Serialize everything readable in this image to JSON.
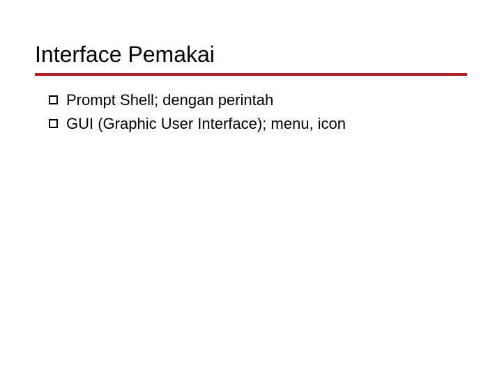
{
  "slide": {
    "title": "Interface Pemakai",
    "bullets": [
      {
        "text": "Prompt Shell; dengan perintah"
      },
      {
        "text": "GUI (Graphic User Interface); menu, icon"
      }
    ]
  }
}
